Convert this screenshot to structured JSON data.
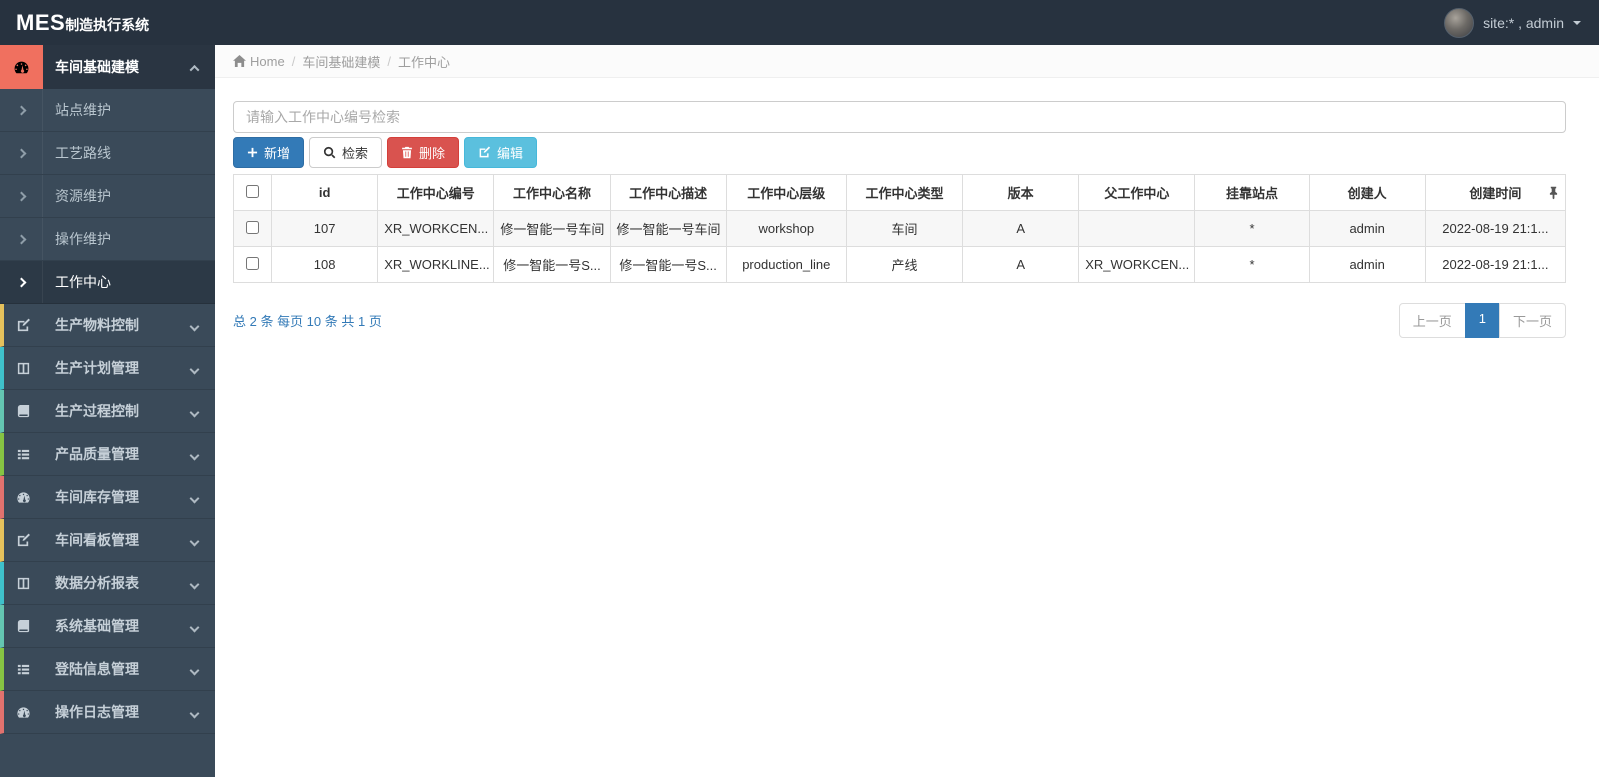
{
  "navbar": {
    "brand_primary": "MES",
    "brand_secondary": "制造执行系统",
    "user_label": "site:* , admin"
  },
  "breadcrumb": {
    "home": "Home",
    "section": "车间基础建模",
    "current": "工作中心",
    "separator": "/"
  },
  "sidebar": {
    "group": {
      "label": "车间基础建模",
      "icon": "gauge-icon",
      "accent": "#f0705f"
    },
    "subitems": [
      {
        "label": "站点维护"
      },
      {
        "label": "工艺路线"
      },
      {
        "label": "资源维护"
      },
      {
        "label": "操作维护"
      },
      {
        "label": "工作中心"
      }
    ],
    "active_subitem": "工作中心",
    "items": [
      {
        "label": "生产物料控制",
        "icon": "pencil-square-icon",
        "accent": "#e5c15c"
      },
      {
        "label": "生产计划管理",
        "icon": "columns-icon",
        "accent": "#3fc1cb"
      },
      {
        "label": "生产过程控制",
        "icon": "book-icon",
        "accent": "#64c5b1"
      },
      {
        "label": "产品质量管理",
        "icon": "list-icon",
        "accent": "#86c443"
      },
      {
        "label": "车间库存管理",
        "icon": "gauge-icon",
        "accent": "#e2726e"
      },
      {
        "label": "车间看板管理",
        "icon": "pencil-square-icon",
        "accent": "#e5c15c"
      },
      {
        "label": "数据分析报表",
        "icon": "columns-icon",
        "accent": "#3fc1cb"
      },
      {
        "label": "系统基础管理",
        "icon": "book-icon",
        "accent": "#64c5b1"
      },
      {
        "label": "登陆信息管理",
        "icon": "list-icon",
        "accent": "#86c443"
      },
      {
        "label": "操作日志管理",
        "icon": "gauge-icon",
        "accent": "#e2726e"
      }
    ]
  },
  "search": {
    "placeholder": "请输入工作中心编号检索"
  },
  "toolbar": {
    "add_label": "新增",
    "search_label": "检索",
    "delete_label": "删除",
    "edit_label": "编辑",
    "colors": {
      "add": "#337ab7",
      "delete": "#d9534f",
      "edit": "#5bc0de"
    }
  },
  "table": {
    "columns": [
      "id",
      "工作中心编号",
      "工作中心名称",
      "工作中心描述",
      "工作中心层级",
      "工作中心类型",
      "版本",
      "父工作中心",
      "挂靠站点",
      "创建人",
      "创建时间"
    ],
    "rows": [
      [
        "107",
        "XR_WORKCEN...",
        "修一智能一号车间",
        "修一智能一号车间",
        "workshop",
        "车间",
        "A",
        "",
        "*",
        "admin",
        "2022-08-19 21:1..."
      ],
      [
        "108",
        "XR_WORKLINE...",
        "修一智能一号S...",
        "修一智能一号S...",
        "production_line",
        "产线",
        "A",
        "XR_WORKCEN...",
        "*",
        "admin",
        "2022-08-19 21:1..."
      ]
    ]
  },
  "pagination": {
    "summary": "总 2 条  每页 10 条  共 1 页",
    "prev_label": "上一页",
    "page_label": "1",
    "next_label": "下一页",
    "active_color": "#337ab7",
    "summary_color": "#337ab7"
  }
}
